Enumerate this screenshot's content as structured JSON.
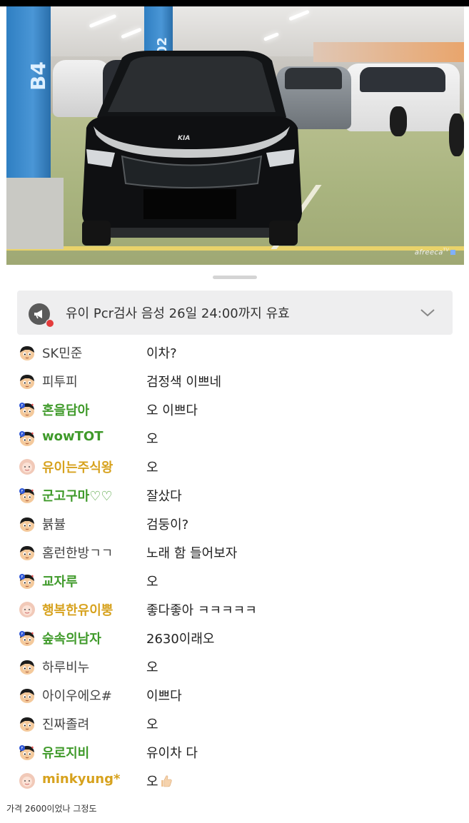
{
  "video": {
    "pillar_left_label": "B4",
    "pillar_mid_label": "02",
    "car_badge": "KIA",
    "watermark": "afreeca",
    "watermark_suffix": "TV"
  },
  "notice": {
    "icon": "megaphone-icon",
    "live_dot_color": "#e43c3c",
    "text": "유이 Pcr검사 음성 26일 24:00까지 유효",
    "expand_icon": "chevron-down-icon"
  },
  "colors": {
    "fan_nick": "#3f9a2a",
    "vip_nick": "#d7a21e",
    "normal_nick": "#444444"
  },
  "chat": [
    {
      "nick": "SK민준",
      "msg": "이차?",
      "tier": "normal"
    },
    {
      "nick": "피투피",
      "msg": "검정색 이쁘네",
      "tier": "normal"
    },
    {
      "nick": "혼을담아",
      "msg": "오 이쁘다",
      "tier": "fan"
    },
    {
      "nick": "wowTOT",
      "msg": "오",
      "tier": "fan"
    },
    {
      "nick": "유이는주식왕",
      "msg": "오",
      "tier": "vip"
    },
    {
      "nick": "군고구마♡♡",
      "msg": "잘샀다",
      "tier": "fan"
    },
    {
      "nick": "뷹뷸",
      "msg": "검둥이?",
      "tier": "normal"
    },
    {
      "nick": "홈런한방ㄱㄱ",
      "msg": "노래 함 들어보자",
      "tier": "normal"
    },
    {
      "nick": "교자루",
      "msg": "오",
      "tier": "fan"
    },
    {
      "nick": "행복한유이뿡",
      "msg": "좋다좋아 ㅋㅋㅋㅋㅋ",
      "tier": "vip"
    },
    {
      "nick": "숲속의남자",
      "msg": "2630이래오",
      "tier": "fan"
    },
    {
      "nick": "하루비누",
      "msg": "오",
      "tier": "normal"
    },
    {
      "nick": "아이우에오#",
      "msg": "이쁘다",
      "tier": "normal"
    },
    {
      "nick": "진짜졸려",
      "msg": "오",
      "tier": "normal"
    },
    {
      "nick": "유로지비",
      "msg": "유이차 다",
      "tier": "fan"
    },
    {
      "nick": "minkyung*",
      "msg": "오",
      "tier": "vip",
      "emoji": "thumbs-up-icon"
    }
  ],
  "caption": "가격 2600이었나 그정도"
}
